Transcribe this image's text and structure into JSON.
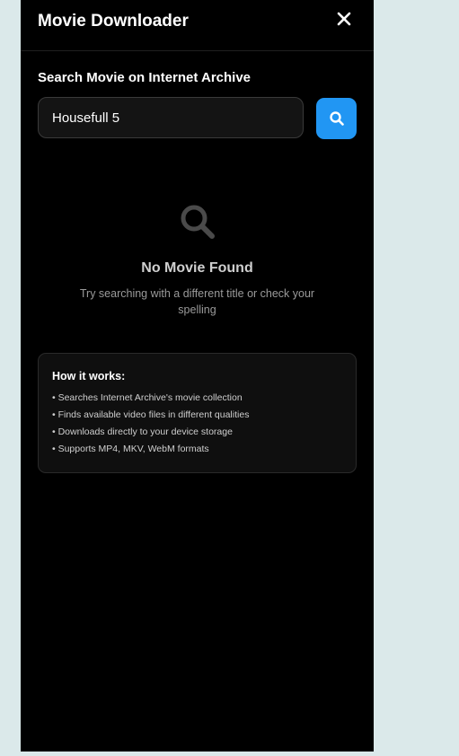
{
  "header": {
    "title": "Movie Downloader",
    "close_icon": "close-icon"
  },
  "search": {
    "label": "Search Movie on Internet Archive",
    "value": "Housefull 5",
    "button_icon": "search-icon",
    "button_color": "#2196f3"
  },
  "empty_state": {
    "icon": "search-icon",
    "title": "No Movie Found",
    "subtitle": "Try searching with a different title or check your spelling"
  },
  "how_it_works": {
    "title": "How it works:",
    "items": [
      "• Searches Internet Archive's movie collection",
      "• Finds available video files in different qualities",
      "• Downloads directly to your device storage",
      "• Supports MP4, MKV, WebM formats"
    ]
  },
  "colors": {
    "panel_background": "#000000",
    "page_background": "#dbe9ea",
    "accent": "#2196f3"
  }
}
